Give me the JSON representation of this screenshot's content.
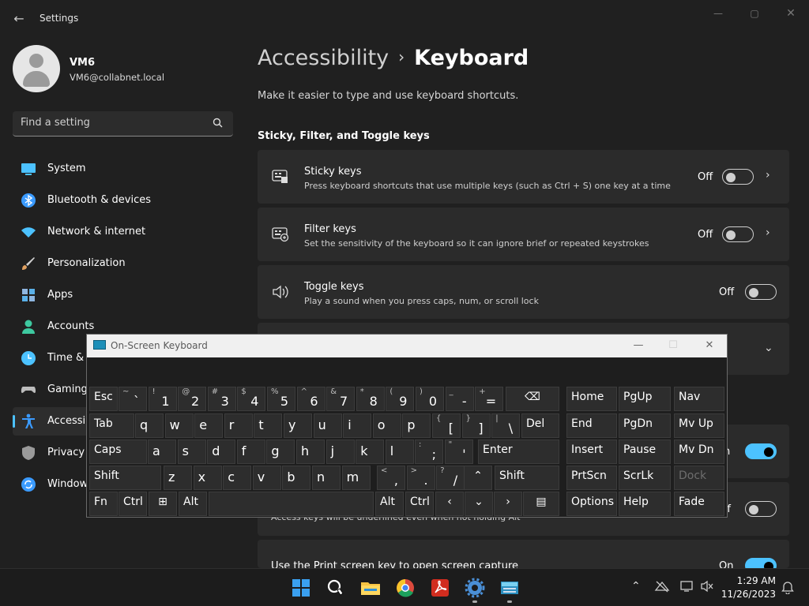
{
  "window": {
    "title": "Settings",
    "back_glyph": "←",
    "minimize": "—",
    "maximize": "▢",
    "close": "✕"
  },
  "user": {
    "name": "VM6",
    "email": "VM6@collabnet.local"
  },
  "search": {
    "placeholder": "Find a setting",
    "icon": "search-icon"
  },
  "nav": {
    "items": [
      {
        "label": "System",
        "icon": "system-icon",
        "color": "#4cc2ff"
      },
      {
        "label": "Bluetooth & devices",
        "icon": "bluetooth-icon",
        "color": "#3b9bff"
      },
      {
        "label": "Network & internet",
        "icon": "wifi-icon",
        "color": "#4cc2ff"
      },
      {
        "label": "Personalization",
        "icon": "brush-icon",
        "color": "#e0a060"
      },
      {
        "label": "Apps",
        "icon": "apps-icon",
        "color": "#8fb6e0"
      },
      {
        "label": "Accounts",
        "icon": "accounts-icon",
        "color": "#3ec9a0"
      },
      {
        "label": "Time &",
        "icon": "clock-icon",
        "color": "#4cc2ff"
      },
      {
        "label": "Gaming",
        "icon": "gamepad-icon",
        "color": "#bdbdbd"
      },
      {
        "label": "Accessib",
        "icon": "accessibility-icon",
        "color": "#3b9bff",
        "active": true
      },
      {
        "label": "Privacy",
        "icon": "shield-icon",
        "color": "#9a9a9a"
      },
      {
        "label": "Window",
        "icon": "update-icon",
        "color": "#3b9bff"
      }
    ]
  },
  "main": {
    "breadcrumb_parent": "Accessibility",
    "breadcrumb_sep": "›",
    "breadcrumb_current": "Keyboard",
    "description": "Make it easier to type and use keyboard shortcuts.",
    "section_heading": "Sticky, Filter, and Toggle keys",
    "cards": [
      {
        "title": "Sticky keys",
        "desc": "Press keyboard shortcuts that use multiple keys (such as Ctrl + S) one key at a time",
        "state": "Off",
        "icon": "sticky-keys-icon"
      },
      {
        "title": "Filter keys",
        "desc": "Set the sensitivity of the keyboard so it can ignore brief or repeated keystrokes",
        "state": "Off",
        "icon": "filter-keys-icon"
      },
      {
        "title": "Toggle keys",
        "desc": "Play a sound when you press caps, num, or scroll lock",
        "state": "Off",
        "icon": "speaker-icon"
      }
    ],
    "partial_rows": {
      "row1_state": "n",
      "row2_state": "ff",
      "row2_desc": "Access keys will be underlined even when not holding Alt",
      "row3_title": "Use the Print screen key to open screen capture",
      "row3_state": "On"
    }
  },
  "osk": {
    "title": "On-Screen Keyboard",
    "minimize": "—",
    "maximize": "☐",
    "close": "✕",
    "keys": {
      "esc": "Esc",
      "tab": "Tab",
      "caps": "Caps",
      "shift": "Shift",
      "fn": "Fn",
      "ctrl": "Ctrl",
      "alt": "Alt",
      "enter": "Enter",
      "del": "Del",
      "backspace": "⌫",
      "home": "Home",
      "pgup": "PgUp",
      "nav": "Nav",
      "end": "End",
      "pgdn": "PgDn",
      "mvup": "Mv Up",
      "insert": "Insert",
      "pause": "Pause",
      "mvdn": "Mv Dn",
      "prtscn": "PrtScn",
      "scrlk": "ScrLk",
      "dock": "Dock",
      "options": "Options",
      "help": "Help",
      "fade": "Fade",
      "up": "⌃",
      "down": "⌄",
      "left": "‹",
      "right": "›",
      "menu": "▤",
      "win": "⊞",
      "row1": [
        [
          "~",
          "`"
        ],
        [
          "!",
          "1"
        ],
        [
          "@",
          "2"
        ],
        [
          "#",
          "3"
        ],
        [
          "$",
          "4"
        ],
        [
          "%",
          "5"
        ],
        [
          "^",
          "6"
        ],
        [
          "&",
          "7"
        ],
        [
          "*",
          "8"
        ],
        [
          "(",
          "9"
        ],
        [
          ")",
          "0"
        ],
        [
          "_",
          "-"
        ],
        [
          "+",
          "="
        ]
      ],
      "row2": [
        "q",
        "w",
        "e",
        "r",
        "t",
        "y",
        "u",
        "i",
        "o",
        "p"
      ],
      "row2_sym": [
        [
          "{",
          "["
        ],
        [
          "}",
          "]"
        ],
        [
          "|",
          "\\"
        ]
      ],
      "row3": [
        "a",
        "s",
        "d",
        "f",
        "g",
        "h",
        "j",
        "k",
        "l"
      ],
      "row3_sym": [
        [
          ":",
          ";"
        ],
        [
          "\"",
          "'"
        ]
      ],
      "row4": [
        "z",
        "x",
        "c",
        "v",
        "b",
        "n",
        "m"
      ],
      "row4_sym": [
        [
          "<",
          ","
        ],
        [
          ">",
          "."
        ],
        [
          "?",
          "/"
        ]
      ]
    }
  },
  "taskbar": {
    "icons": [
      "windows-start-icon",
      "search-icon",
      "file-explorer-icon",
      "chrome-icon",
      "acrobat-icon",
      "settings-icon",
      "osk-icon"
    ],
    "time": "1:29 AM",
    "date": "11/26/2023",
    "tray_chevron": "⌃"
  }
}
